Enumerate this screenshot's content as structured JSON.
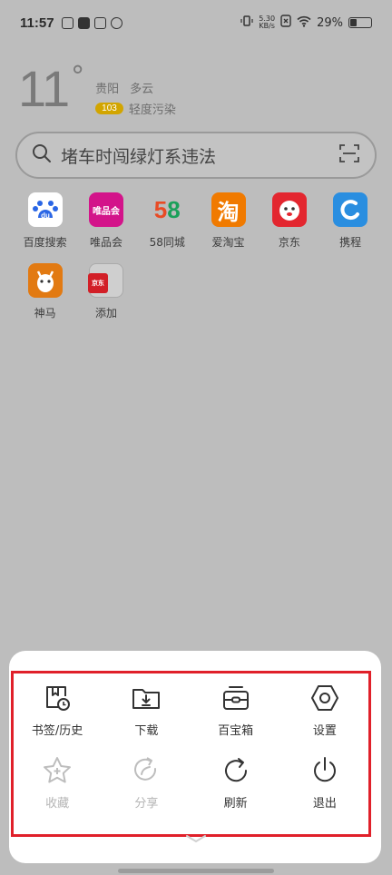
{
  "status_bar": {
    "time": "11:57",
    "net_speed_value": "5.30",
    "net_speed_unit": "KB/s",
    "battery_percent": "29%",
    "battery_level": 0.29
  },
  "weather": {
    "temperature": "11",
    "degree": "°",
    "city": "贵阳",
    "condition": "多云",
    "aqi": "103",
    "aqi_label": "轻度污染"
  },
  "search": {
    "query": "堵车时闯绿灯系违法"
  },
  "shortcuts": [
    {
      "label": "百度搜索",
      "icon": "baidu-icon",
      "color": "#2a66e5",
      "glyph": "du"
    },
    {
      "label": "唯品会",
      "icon": "vipshop-icon",
      "color": "#d3148a",
      "glyph": "唯品会"
    },
    {
      "label": "58同城",
      "icon": "58-icon",
      "color": "#ffffff",
      "glyph": "58"
    },
    {
      "label": "爱淘宝",
      "icon": "taobao-icon",
      "color": "#f07a00",
      "glyph": "淘"
    },
    {
      "label": "京东",
      "icon": "jd-icon",
      "color": "#e3262f",
      "glyph": "JD"
    },
    {
      "label": "携程",
      "icon": "ctrip-icon",
      "color": "#2a8ee0",
      "glyph": "C"
    },
    {
      "label": "神马",
      "icon": "shenma-icon",
      "color": "#e27a12",
      "glyph": "马"
    },
    {
      "label": "添加",
      "icon": "add-icon",
      "color": "#d9d9d9",
      "glyph": "京东"
    }
  ],
  "menu": {
    "items": [
      {
        "label": "书签/历史",
        "icon": "bookmark-history-icon",
        "enabled": true
      },
      {
        "label": "下载",
        "icon": "download-icon",
        "enabled": true
      },
      {
        "label": "百宝箱",
        "icon": "toolbox-icon",
        "enabled": true
      },
      {
        "label": "设置",
        "icon": "settings-icon",
        "enabled": true
      },
      {
        "label": "收藏",
        "icon": "star-icon",
        "enabled": false
      },
      {
        "label": "分享",
        "icon": "share-icon",
        "enabled": false
      },
      {
        "label": "刷新",
        "icon": "refresh-icon",
        "enabled": true
      },
      {
        "label": "退出",
        "icon": "power-icon",
        "enabled": true
      }
    ]
  },
  "colors": {
    "highlight": "#e0202a",
    "aqi_badge": "#d2a500"
  }
}
